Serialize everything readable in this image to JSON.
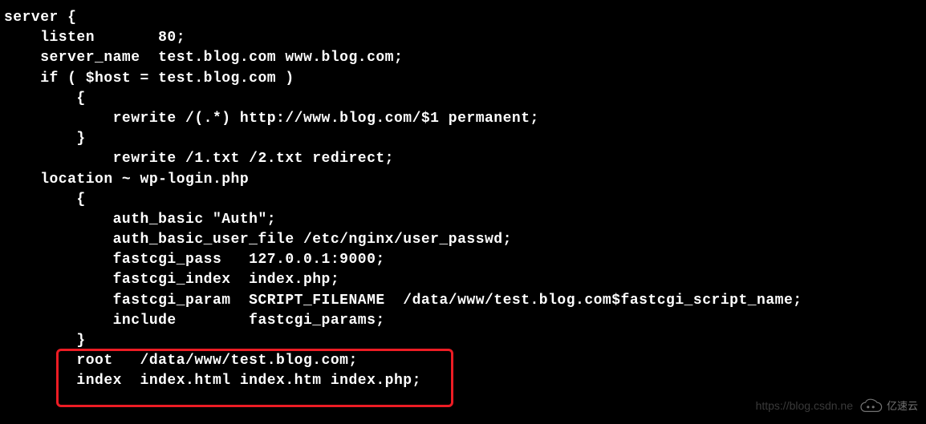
{
  "code": {
    "lines": [
      "server {",
      "    listen       80;",
      "    server_name  test.blog.com www.blog.com;",
      "    if ( $host = test.blog.com )",
      "        {",
      "            rewrite /(.*) http://www.blog.com/$1 permanent;",
      "        }",
      "            rewrite /1.txt /2.txt redirect;",
      "    location ~ wp-login.php",
      "        {",
      "            auth_basic \"Auth\";",
      "            auth_basic_user_file /etc/nginx/user_passwd;",
      "            fastcgi_pass   127.0.0.1:9000;",
      "            fastcgi_index  index.php;",
      "            fastcgi_param  SCRIPT_FILENAME  /data/www/test.blog.com$fastcgi_script_name;",
      "            include        fastcgi_params;",
      "        }",
      "",
      "        root   /data/www/test.blog.com;",
      "        index  index.html index.htm index.php;"
    ]
  },
  "watermark": {
    "url": "https://blog.csdn.ne",
    "brand": "亿速云"
  }
}
